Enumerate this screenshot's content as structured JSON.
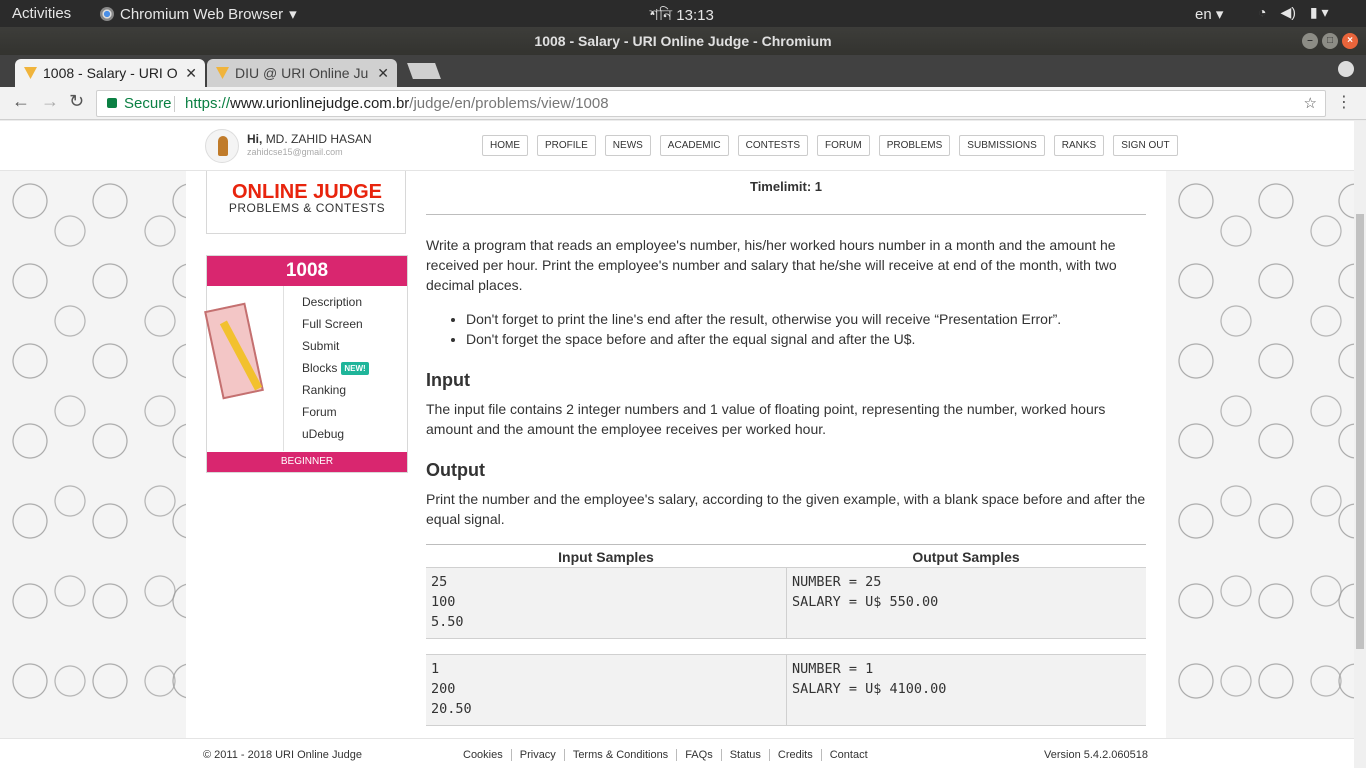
{
  "system": {
    "activities": "Activities",
    "app_name": "Chromium Web Browser",
    "clock": "শনি 13:13",
    "lang": "en"
  },
  "window": {
    "title": "1008 - Salary - URI Online Judge - Chromium"
  },
  "tabs": [
    {
      "label": "1008 - Salary - URI O"
    },
    {
      "label": "DIU @ URI Online Ju"
    }
  ],
  "address": {
    "secure": "Secure",
    "url_scheme": "https://",
    "url_host": "www.urionlinejudge.com.br",
    "url_path": "/judge/en/problems/view/1008"
  },
  "user": {
    "greeting": "Hi,",
    "name": "MD. ZAHID HASAN",
    "email": "zahidcse15@gmail.com"
  },
  "nav": [
    "HOME",
    "PROFILE",
    "NEWS",
    "ACADEMIC",
    "CONTESTS",
    "FORUM",
    "PROBLEMS",
    "SUBMISSIONS",
    "RANKS",
    "SIGN OUT"
  ],
  "logo": {
    "title": "ONLINE JUDGE",
    "subtitle": "PROBLEMS & CONTESTS"
  },
  "problem": {
    "number": "1008",
    "menu": [
      "Description",
      "Full Screen",
      "Submit",
      "Blocks",
      "Ranking",
      "Forum",
      "uDebug"
    ],
    "new_badge": "NEW!",
    "level": "BEGINNER",
    "timelimit": "Timelimit: 1",
    "description": "Write a program that reads an employee's number, his/her worked hours number in a month and the amount he received per hour. Print the employee's number and salary that he/she will receive at end of the month, with two decimal places.",
    "notes": [
      "Don't forget to print the line's end after the result, otherwise you will receive “Presentation Error”.",
      "Don't forget the space before and after the equal signal and after the U$."
    ],
    "input_title": "Input",
    "input_text": "The input file contains 2 integer numbers and 1 value of floating point, representing the number, worked hours amount and the amount the employee receives per worked hour.",
    "output_title": "Output",
    "output_text": "Print the number and the employee's salary, according to the given example, with a blank space before and after the equal signal."
  },
  "samples": {
    "input_header": "Input Samples",
    "output_header": "Output Samples",
    "rows": [
      {
        "input": [
          "25",
          "100",
          "5.50"
        ],
        "output": [
          "NUMBER = 25",
          "SALARY = U$ 550.00"
        ]
      },
      {
        "input": [
          "1",
          "200",
          "20.50"
        ],
        "output": [
          "NUMBER = 1",
          "SALARY = U$ 4100.00"
        ]
      }
    ]
  },
  "footer": {
    "copyright": "© 2011 - 2018 URI Online Judge",
    "links": [
      "Cookies",
      "Privacy",
      "Terms & Conditions",
      "FAQs",
      "Status",
      "Credits",
      "Contact"
    ],
    "version": "Version 5.4.2.060518"
  }
}
